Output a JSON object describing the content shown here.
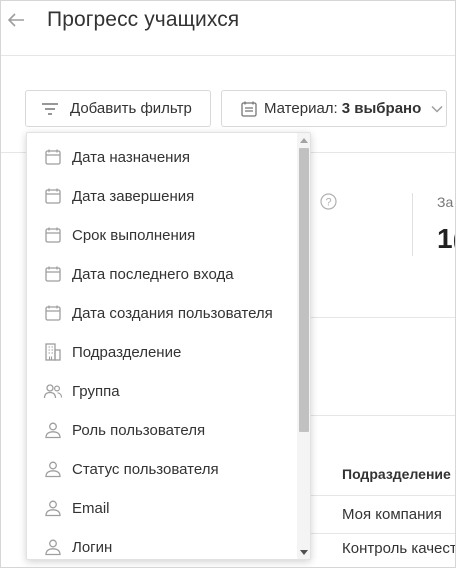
{
  "header": {
    "title": "Прогресс учащихся"
  },
  "toolbar": {
    "add_filter_label": "Добавить фильтр",
    "material_label": "Материал:",
    "material_value": "3 выбрано"
  },
  "stats": {
    "label": "За",
    "value": "1("
  },
  "table": {
    "column_header": "Подразделение",
    "rows": [
      "Моя компания",
      "Контроль качест"
    ]
  },
  "filter_menu": {
    "items": [
      {
        "label": "Дата назначения",
        "icon": "calendar-icon"
      },
      {
        "label": "Дата завершения",
        "icon": "calendar-icon"
      },
      {
        "label": "Срок выполнения",
        "icon": "calendar-icon"
      },
      {
        "label": "Дата последнего входа",
        "icon": "calendar-icon"
      },
      {
        "label": "Дата создания пользователя",
        "icon": "calendar-icon"
      },
      {
        "label": "Подразделение",
        "icon": "building-icon"
      },
      {
        "label": "Группа",
        "icon": "group-icon"
      },
      {
        "label": "Роль пользователя",
        "icon": "user-icon"
      },
      {
        "label": "Статус пользователя",
        "icon": "user-icon"
      },
      {
        "label": "Email",
        "icon": "user-icon"
      },
      {
        "label": "Логин",
        "icon": "user-icon"
      }
    ]
  },
  "colors": {
    "icon": "#9e9e9e",
    "text": "#333333",
    "border": "#d9d9d9"
  }
}
